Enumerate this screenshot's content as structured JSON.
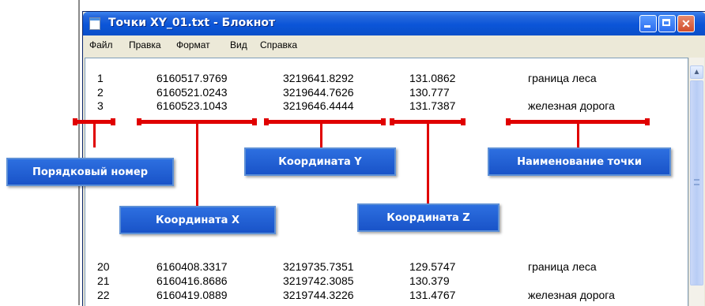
{
  "window": {
    "title": "Точки XY_01.txt - Блокнот",
    "buttons": {
      "minimize": "",
      "maximize": "",
      "close": "✕"
    }
  },
  "menu": [
    "Файл",
    "Правка",
    "Формат",
    "Вид",
    "Справка"
  ],
  "rows_top": [
    {
      "num": "1",
      "x": "6160517.9769",
      "y": "3219641.8292",
      "z": "131.0862",
      "name": "граница леса"
    },
    {
      "num": "2",
      "x": "6160521.0243",
      "y": "3219644.7626",
      "z": "130.777",
      "name": ""
    },
    {
      "num": "3",
      "x": "6160523.1043",
      "y": "3219646.4444",
      "z": "131.7387",
      "name": "железная дорога"
    }
  ],
  "rows_bottom": [
    {
      "num": "20",
      "x": "6160408.3317",
      "y": "3219735.7351",
      "z": "129.5747",
      "name": "граница леса"
    },
    {
      "num": "21",
      "x": "6160416.8686",
      "y": "3219742.3085",
      "z": "130.379",
      "name": ""
    },
    {
      "num": "22",
      "x": "6160419.0889",
      "y": "3219744.3226",
      "z": "131.4767",
      "name": "железная дорога"
    }
  ],
  "callouts": {
    "num": "Порядковый номер",
    "x": "Координата X",
    "y": "Координата Y",
    "z": "Координата Z",
    "name": "Наименование точки"
  },
  "icons": {
    "scroll_up": "scroll-up-arrow-icon",
    "app": "notepad-icon"
  },
  "colors": {
    "annotation_red": "#e00000",
    "callout_blue": "#1953c8",
    "titlebar_blue": "#0b55d8"
  }
}
